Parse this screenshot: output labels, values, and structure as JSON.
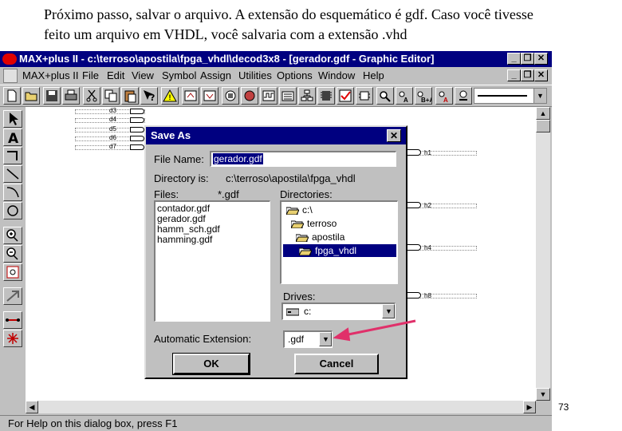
{
  "caption": {
    "line1": "Próximo passo, salvar o arquivo. A extensão do esquemático é gdf. Caso você tivesse",
    "line2": "feito um arquivo em VHDL, você salvaria com a extensão .vhd"
  },
  "window": {
    "title": "MAX+plus II - c:\\terroso\\apostila\\fpga_vhdl\\decod3x8 - [gerador.gdf - Graphic Editor]"
  },
  "menu": {
    "items": [
      "MAX+plus II",
      "File",
      "Edit",
      "View",
      "Symbol",
      "Assign",
      "Utilities",
      "Options",
      "Window",
      "Help"
    ]
  },
  "canvas": {
    "inputs": [
      "d0",
      "d1",
      "d2",
      "d3",
      "d4",
      "d5",
      "d6",
      "d7"
    ],
    "outputs": [
      "h1",
      "h2",
      "h4",
      "h8"
    ]
  },
  "status": {
    "text": "For Help on this dialog box, press F1"
  },
  "slide_number": "73",
  "dialog": {
    "title": "Save As",
    "file_name_label": "File Name:",
    "file_name_value": "gerador.gdf",
    "directory_label": "Directory is:",
    "directory_value": "c:\\terroso\\apostila\\fpga_vhdl",
    "files_label": "Files:",
    "files_filter": "*.gdf",
    "files": [
      "contador.gdf",
      "gerador.gdf",
      "hamm_sch.gdf",
      "hamming.gdf"
    ],
    "directories_label": "Directories:",
    "directories": [
      "c:\\",
      "terroso",
      "apostila",
      "fpga_vhdl"
    ],
    "drives_label": "Drives:",
    "drive_value": "c:",
    "auto_ext_label": "Automatic Extension:",
    "auto_ext_value": ".gdf",
    "ok_label": "OK",
    "cancel_label": "Cancel"
  },
  "colors": {
    "titlebar": "#000080",
    "face": "#c0c0c0",
    "arrow": "#e0306a"
  }
}
